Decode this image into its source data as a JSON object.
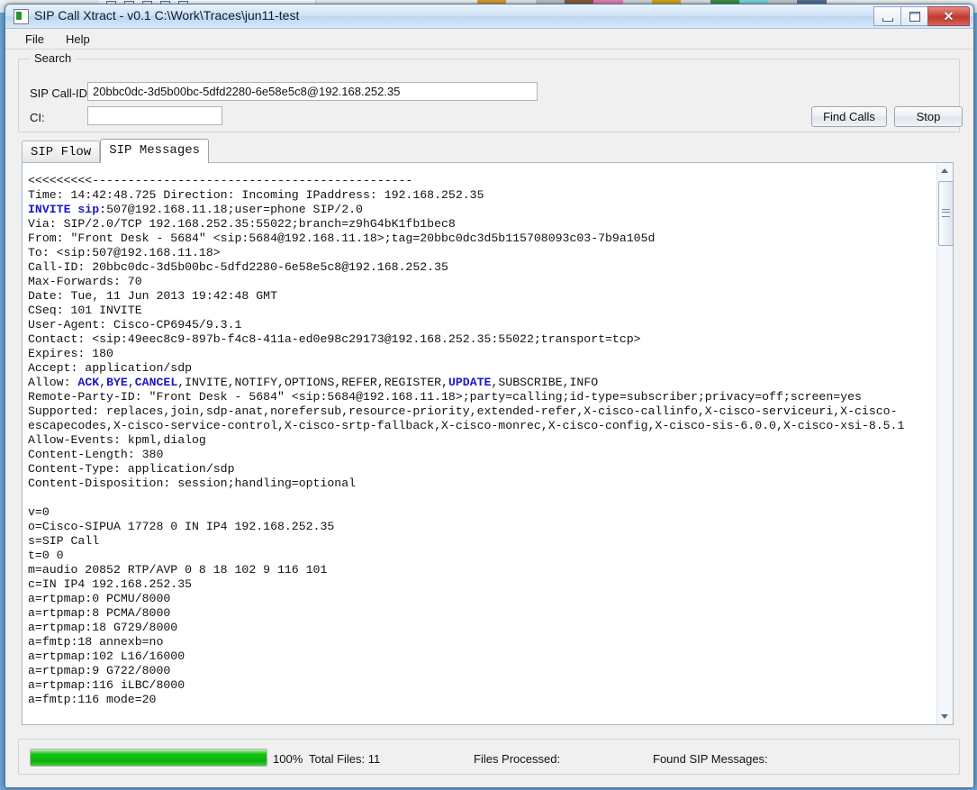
{
  "window": {
    "title": "SIP Call Xtract - v0.1 C:\\Work\\Traces\\jun11-test",
    "app_icon": "app-icon",
    "minimize_label": "",
    "restore_label": "",
    "close_label": "✕"
  },
  "menu": {
    "items": [
      {
        "label": "File"
      },
      {
        "label": "Help"
      }
    ]
  },
  "search": {
    "legend": "Search",
    "callid_label": "SIP Call-ID:",
    "callid_value": "20bbc0dc-3d5b00bc-5dfd2280-6e58e5c8@192.168.252.35",
    "callid_placeholder": "",
    "ci_label": "CI:",
    "ci_value": "",
    "ci_placeholder": "",
    "find_button": "Find Calls",
    "stop_button": "Stop"
  },
  "tabs": [
    {
      "label": "SIP Flow",
      "active": false
    },
    {
      "label": "SIP Messages",
      "active": true
    }
  ],
  "message_view": {
    "separator_line": "<<<<<<<<<---------------------------------------------",
    "lines": [
      "<<<<<<<<<---------------------------------------------",
      "Time: 14:42:48.725 Direction: Incoming IPaddress: 192.168.252.35",
      "INVITE sip:507@192.168.11.18;user=phone SIP/2.0",
      "Via: SIP/2.0/TCP 192.168.252.35:55022;branch=z9hG4bK1fb1bec8",
      "From: \"Front Desk - 5684\" <sip:5684@192.168.11.18>;tag=20bbc0dc3d5b115708093c03-7b9a105d",
      "To: <sip:507@192.168.11.18>",
      "Call-ID: 20bbc0dc-3d5b00bc-5dfd2280-6e58e5c8@192.168.252.35",
      "Max-Forwards: 70",
      "Date: Tue, 11 Jun 2013 19:42:48 GMT",
      "CSeq: 101 INVITE",
      "User-Agent: Cisco-CP6945/9.3.1",
      "Contact: <sip:49eec8c9-897b-f4c8-411a-ed0e98c29173@192.168.252.35:55022;transport=tcp>",
      "Expires: 180",
      "Accept: application/sdp",
      "Allow: ACK,BYE,CANCEL,INVITE,NOTIFY,OPTIONS,REFER,REGISTER,UPDATE,SUBSCRIBE,INFO",
      "Remote-Party-ID: \"Front Desk - 5684\" <sip:5684@192.168.11.18>;party=calling;id-type=subscriber;privacy=off;screen=yes",
      "Supported: replaces,join,sdp-anat,norefersub,resource-priority,extended-refer,X-cisco-callinfo,X-cisco-serviceuri,X-cisco-",
      "escapecodes,X-cisco-service-control,X-cisco-srtp-fallback,X-cisco-monrec,X-cisco-config,X-cisco-sis-6.0.0,X-cisco-xsi-8.5.1",
      "Allow-Events: kpml,dialog",
      "Content-Length: 380",
      "Content-Type: application/sdp",
      "Content-Disposition: session;handling=optional",
      "",
      "v=0",
      "o=Cisco-SIPUA 17728 0 IN IP4 192.168.252.35",
      "s=SIP Call",
      "t=0 0",
      "m=audio 20852 RTP/AVP 0 8 18 102 9 116 101",
      "c=IN IP4 192.168.252.35",
      "a=rtpmap:0 PCMU/8000",
      "a=rtpmap:8 PCMA/8000",
      "a=rtpmap:18 G729/8000",
      "a=fmtp:18 annexb=no",
      "a=rtpmap:102 L16/16000",
      "a=rtpmap:9 G722/8000",
      "a=rtpmap:116 iLBC/8000",
      "a=fmtp:116 mode=20"
    ],
    "keywords": [
      "INVITE sip:",
      "ACK",
      "BYE",
      "CANCEL",
      "UPDATE"
    ],
    "keyword_color": "#1a18c8",
    "scroll_up_icon": "chevron-up-icon",
    "scroll_down_icon": "chevron-down-icon"
  },
  "status": {
    "progress_percent": 100,
    "percent_label": "100%",
    "total_files": "Total Files: 11",
    "files_processed": "Files Processed:",
    "found_messages": "Found SIP Messages:",
    "progress_color": "#0bb00b"
  }
}
